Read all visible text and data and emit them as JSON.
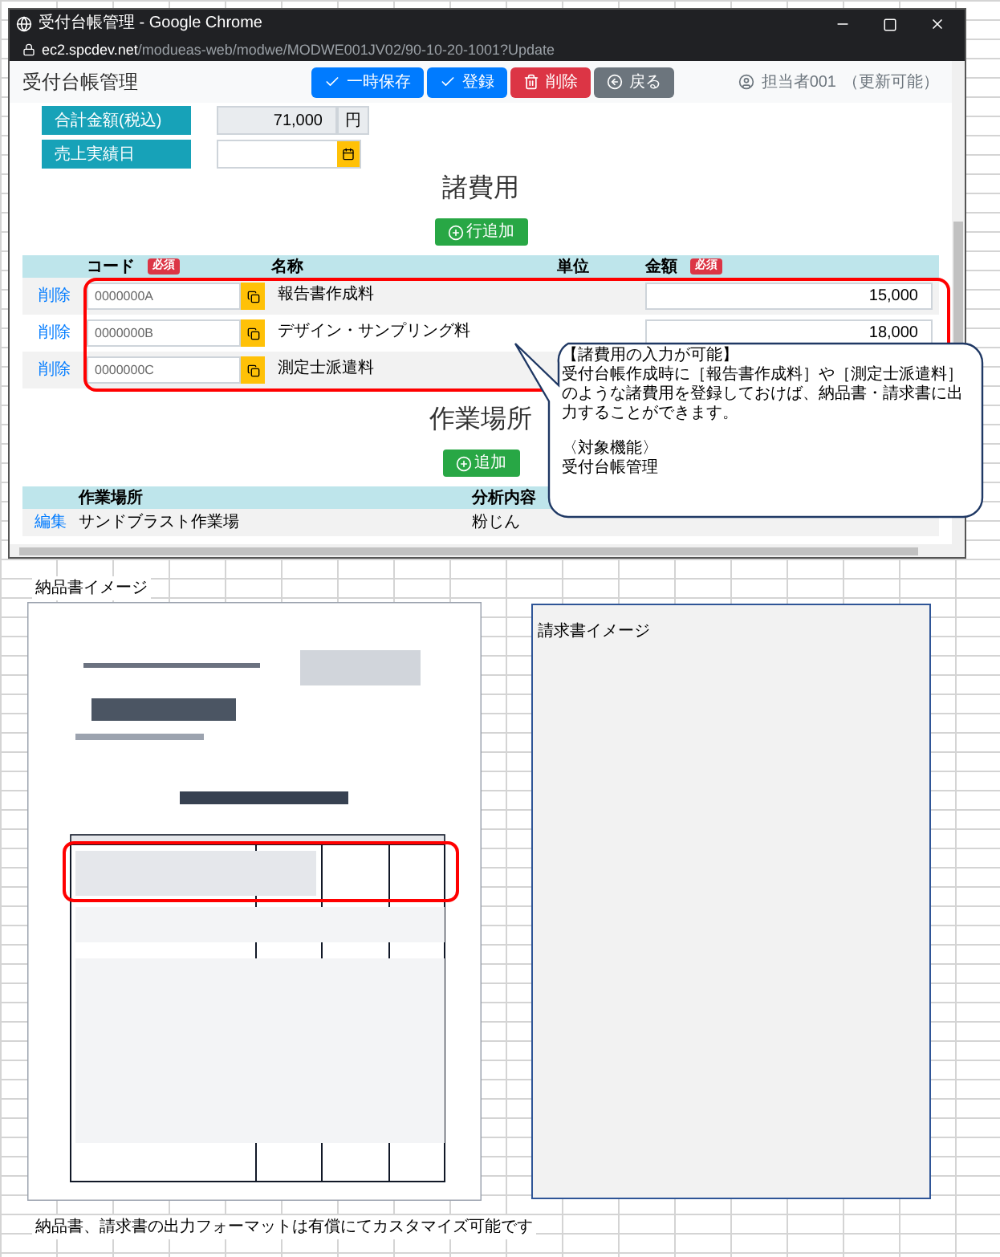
{
  "browser": {
    "title": "受付台帳管理 - Google Chrome",
    "url_host": "ec2.spcdev.net",
    "url_path": "/modueas-web/modwe/MODWE001JV02/90-10-20-1001?Update"
  },
  "app": {
    "title": "受付台帳管理",
    "toolbar": [
      {
        "label": "一時保存",
        "kind": "save"
      },
      {
        "label": "登録",
        "kind": "register"
      },
      {
        "label": "削除",
        "kind": "delete"
      },
      {
        "label": "戻る",
        "kind": "back"
      }
    ],
    "user": "担当者001",
    "user_note": "（更新可能）"
  },
  "form": [
    {
      "label": "合計金額(税込)",
      "kind": "amount",
      "value": "71,000",
      "unit": "円"
    },
    {
      "label": "売上実績日",
      "kind": "date"
    }
  ],
  "expenses": {
    "title": "諸費用",
    "add_button": "行追加",
    "columns": [
      {
        "label": "コード",
        "badge": "必須"
      },
      {
        "label": "名称"
      },
      {
        "label": "単位"
      },
      {
        "label": "金額",
        "badge": "必須"
      }
    ],
    "rows": [
      {
        "action": "削除",
        "code": "0000000A",
        "name": "報告書作成料",
        "amount": "15,000"
      },
      {
        "action": "削除",
        "code": "0000000B",
        "name": "デザイン・サンプリング料",
        "amount": "18,000"
      },
      {
        "action": "削除",
        "code": "0000000C",
        "name": "測定士派遣料"
      }
    ]
  },
  "work_sites": {
    "title": "作業場所",
    "add_button": "追加",
    "columns": [
      "作業場所",
      "分析内容"
    ],
    "rows": [
      {
        "action": "編集",
        "site": "サンドブラスト作業場",
        "analysis": "粉じん"
      }
    ]
  },
  "callout": {
    "title": "【諸費用の入力が可能】",
    "body": "受付台帳作成時に［報告書作成料］や［測定士派遣料］のような諸費用を登録しておけば、納品書・請求書に出力することができます。",
    "target_label": "〈対象機能〉",
    "target": "受付台帳管理"
  },
  "sheet": {
    "delivery_label": "納品書イメージ",
    "invoice_label": "請求書イメージ",
    "footnote": "納品書、請求書の出力フォーマットは有償にてカスタマイズ可能です"
  }
}
